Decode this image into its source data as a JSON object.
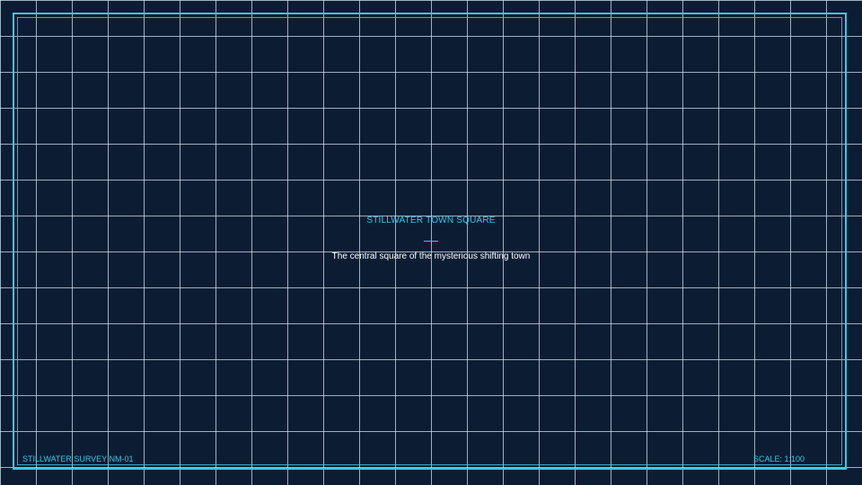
{
  "map": {
    "title": "STILLWATER TOWN SQUARE",
    "description": "The central square of the mysterious shifting town",
    "survey_id": "STILLWATER SURVEY NM-01",
    "scale": "SCALE: 1:100"
  },
  "colors": {
    "background": "#0c1d33",
    "grid": "#cde1f0",
    "accent": "#3ec6e8",
    "text": "#ffffff"
  }
}
